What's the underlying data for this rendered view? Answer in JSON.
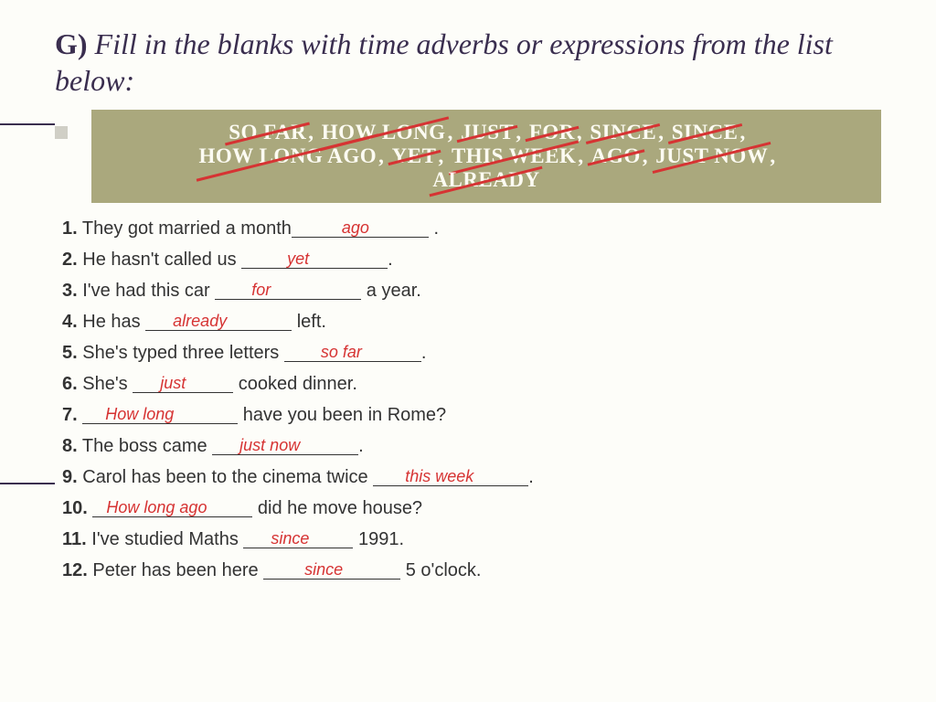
{
  "title_prefix": "G)",
  "title_rest": " Fill in the blanks with time adverbs or expressions from the list below:",
  "bank": {
    "w1": "SO FAR",
    "w2": "HOW LONG",
    "w3": "JUST",
    "w4": "FOR",
    "w5": "SINCE",
    "w6": "SINCE",
    "w7": "HOW LONG AGO",
    "w8": "YET",
    "w9": "THIS WEEK",
    "w10": "AGO",
    "w11": "JUST NOW",
    "w12": "ALREADY"
  },
  "rows": {
    "r1": {
      "n": "1.",
      "a": " They got married a month",
      "ans": "ago",
      "b": " ."
    },
    "r2": {
      "n": "2.",
      "a": "  He hasn't called us ",
      "ans": "yet",
      "b": "."
    },
    "r3": {
      "n": "3.",
      "a": " I've had this car ",
      "ans": "for",
      "b": " a year."
    },
    "r4": {
      "n": "4.",
      "a": " He has ",
      "ans": "already",
      "b": " left."
    },
    "r5": {
      "n": "5.",
      "a": " She's typed three letters ",
      "ans": "so far",
      "b": "."
    },
    "r6": {
      "n": "6.",
      "a": " She's ",
      "ans": "just",
      "b": " cooked dinner."
    },
    "r7": {
      "n": "7.",
      "a": " ",
      "ans": "How long",
      "b": " have you been in Rome?"
    },
    "r8": {
      "n": "8.",
      "a": " The boss came ",
      "ans": "just now",
      "b": "."
    },
    "r9": {
      "n": "9.",
      "a": " Carol has been to the cinema twice ",
      "ans": "this week",
      "b": "."
    },
    "r10": {
      "n": "10.",
      "a": " ",
      "ans": "How long ago",
      "b": " did he move house?"
    },
    "r11": {
      "n": "11.",
      "a": " I've studied Maths ",
      "ans": "since",
      "b": " 1991."
    },
    "r12": {
      "n": "12.",
      "a": " Peter has been here ",
      "ans": "since",
      "b": " 5 o'clock."
    }
  }
}
